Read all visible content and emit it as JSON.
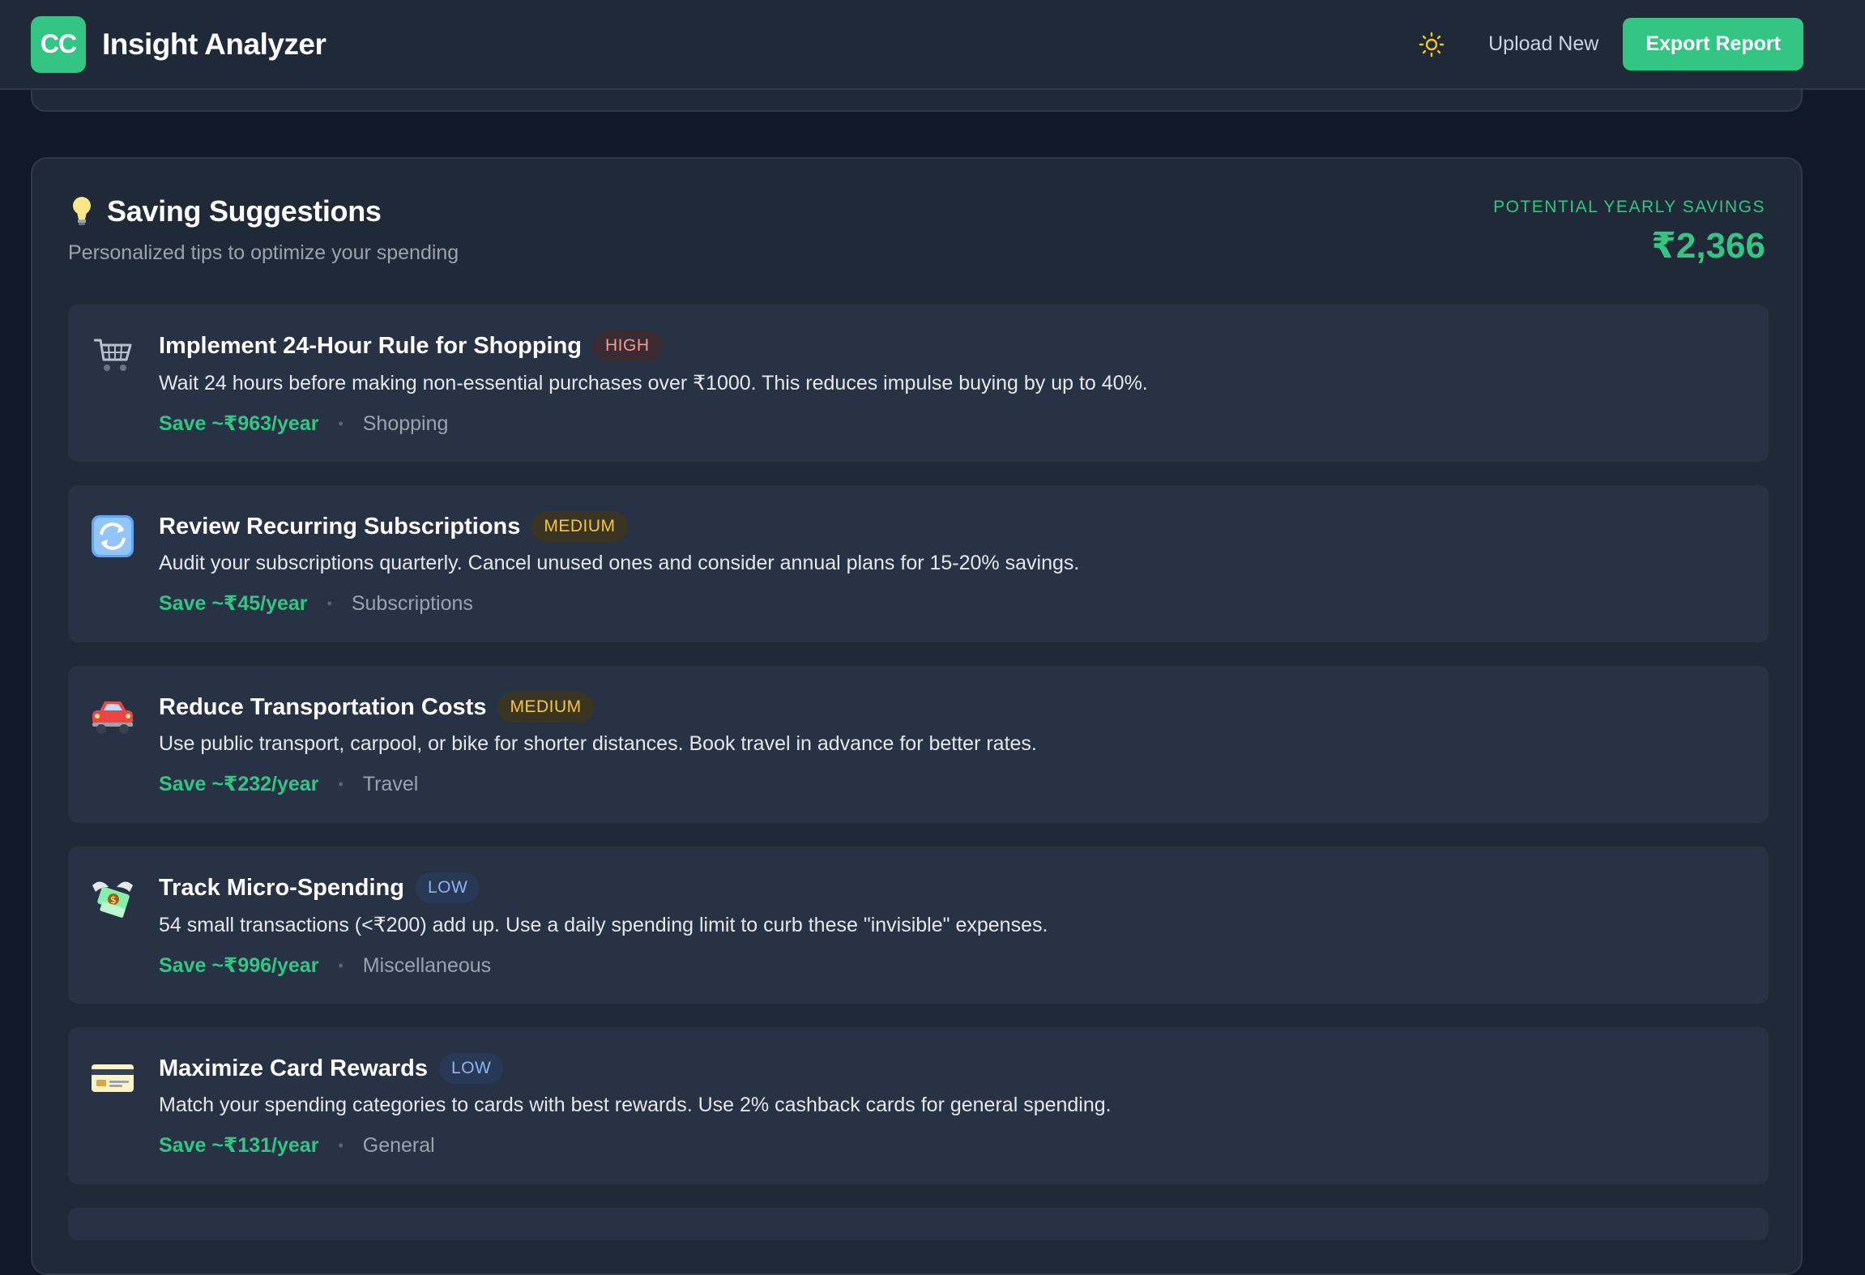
{
  "header": {
    "logo_text": "CC",
    "app_title": "Insight Analyzer",
    "theme_icon": "sun-icon",
    "upload_label": "Upload New",
    "export_label": "Export Report"
  },
  "saving_card": {
    "icon": "lightbulb-icon",
    "title": "Saving Suggestions",
    "subtitle": "Personalized tips to optimize your spending",
    "potential_label": "POTENTIAL YEARLY SAVINGS",
    "potential_amount": "₹2,366",
    "suggestions": [
      {
        "icon": "shopping-cart-icon",
        "title": "Implement 24-Hour Rule for Shopping",
        "priority": "HIGH",
        "description": "Wait 24 hours before making non-essential purchases over ₹1000. This reduces impulse buying by up to 40%.",
        "savings": "Save ~₹963/year",
        "category": "Shopping"
      },
      {
        "icon": "refresh-icon",
        "title": "Review Recurring Subscriptions",
        "priority": "MEDIUM",
        "description": "Audit your subscriptions quarterly. Cancel unused ones and consider annual plans for 15-20% savings.",
        "savings": "Save ~₹45/year",
        "category": "Subscriptions"
      },
      {
        "icon": "car-icon",
        "title": "Reduce Transportation Costs",
        "priority": "MEDIUM",
        "description": "Use public transport, carpool, or bike for shorter distances. Book travel in advance for better rates.",
        "savings": "Save ~₹232/year",
        "category": "Travel"
      },
      {
        "icon": "money-with-wings-icon",
        "title": "Track Micro-Spending",
        "priority": "LOW",
        "description": "54 small transactions (<₹200) add up. Use a daily spending limit to curb these \"invisible\" expenses.",
        "savings": "Save ~₹996/year",
        "category": "Miscellaneous"
      },
      {
        "icon": "credit-card-icon",
        "title": "Maximize Card Rewards",
        "priority": "LOW",
        "description": "Match your spending categories to cards with best rewards. Use 2% cashback cards for general spending.",
        "savings": "Save ~₹131/year",
        "category": "General"
      }
    ]
  },
  "colors": {
    "accent": "#34c584",
    "background": "#111827",
    "card": "#1f2937",
    "item": "#273244",
    "high": "#f19a9a",
    "medium": "#f5c544",
    "low": "#8fb4f5"
  }
}
